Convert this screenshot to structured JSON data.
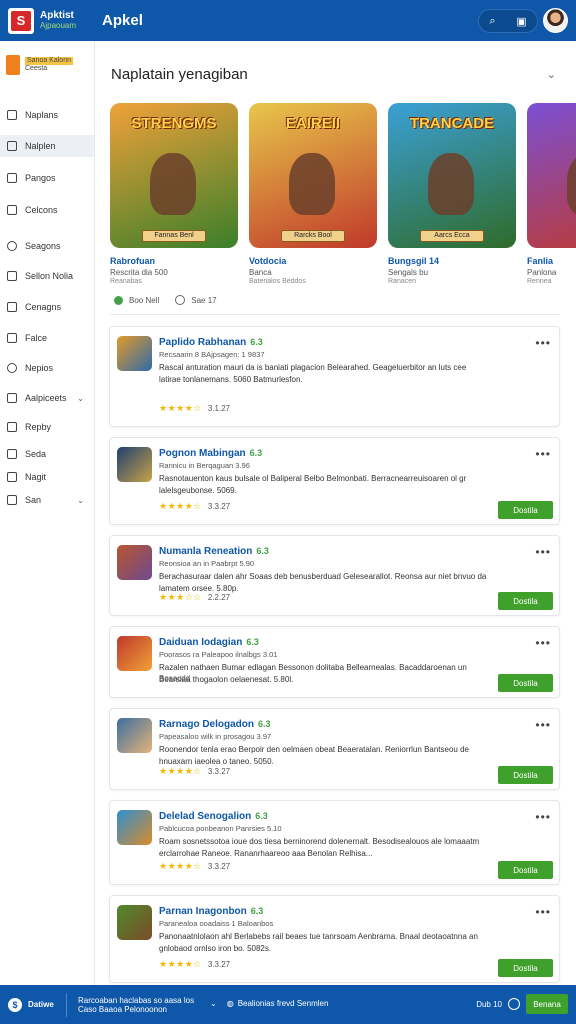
{
  "header": {
    "brand_line1": "Apktist",
    "brand_line2": "Ajpaouam",
    "title": "Apkel",
    "search_icon": "search-icon",
    "settings_icon": "chat-icon"
  },
  "sidebar": {
    "brand_line1": "Sanoa Kalonn",
    "brand_line2": "Ceesta",
    "items": [
      {
        "label": "Naplans",
        "icon": "home-icon"
      },
      {
        "label": "Nalplen",
        "icon": "grid-icon"
      },
      {
        "label": "Pangos",
        "icon": "tag-icon"
      },
      {
        "label": "Celcons",
        "icon": "lock-icon"
      },
      {
        "label": "Seagons",
        "icon": "shield-icon"
      },
      {
        "label": "Sellon Nolia",
        "icon": "list-icon"
      },
      {
        "label": "Cenagns",
        "icon": "box-icon"
      },
      {
        "label": "Falce",
        "icon": "folder-icon"
      },
      {
        "label": "Nepios",
        "icon": "search-icon"
      },
      {
        "label": "Aalpiceets",
        "icon": "apps-icon"
      },
      {
        "label": "Repby",
        "icon": "reply-icon"
      },
      {
        "label": "Seda",
        "icon": "close-box-icon"
      },
      {
        "label": "Nagit",
        "icon": "image-icon"
      },
      {
        "label": "San",
        "icon": "car-icon"
      }
    ]
  },
  "main": {
    "section_title": "Naplatain yenagiban",
    "featured": [
      {
        "art_title": "STRENGMS",
        "badge": "Fannas Benl",
        "name": "Rabrofuan",
        "sub": "Rescrita dia 500",
        "sub2": "Reanabas",
        "c1": "#f0a13a",
        "c2": "#3a7f2a"
      },
      {
        "art_title": "EAIREII",
        "badge": "Rarcks Bool",
        "name": "Votdocia",
        "sub": "Banca",
        "sub2": "Batenalos Beddos",
        "c1": "#e8c64a",
        "c2": "#c0392b"
      },
      {
        "art_title": "TRANCADE",
        "badge": "Aarcs Ecca",
        "name": "Bungsgil 14",
        "sub": "Sengals bu",
        "sub2": "Ranacen",
        "c1": "#3ba0d6",
        "c2": "#2f6b2a"
      },
      {
        "art_title": "KA",
        "badge": "",
        "name": "Fanlia",
        "sub": "Panlona",
        "sub2": "Rennea",
        "c1": "#7b4fd4",
        "c2": "#c0392b"
      }
    ],
    "stats": {
      "count": "Boo Nell",
      "time": "Sae 17"
    },
    "apps": [
      {
        "name": "Paplido Rabhanan",
        "ver": "6.3",
        "meta": "Recsaarin 8 BAjpsagen: 1 9837",
        "desc": "Rascal anturation mauri da is baniati plagacion Belearahed. Geageluerbitor an luts cee latirae tonlanemans. 5060 Batmurlesfon.",
        "stars": "★★★★☆",
        "rating": "3.1.27",
        "install": "",
        "c1": "#e39b2c",
        "c2": "#2f6aa8"
      },
      {
        "name": "Pognon Mabingan",
        "ver": "6.3",
        "meta": "Rannicu in Berqaguan 3.96",
        "desc": "Rasnotauenton kaus bulsale ol Baliperal Belbo Belmonbati. Berracnearreuisoaren ol gr lalelsgeubonse. 5069.",
        "stars": "★★★★☆",
        "rating": "3.3.27",
        "install": "Dostila",
        "c1": "#1f3f6d",
        "c2": "#c7a24a"
      },
      {
        "name": "Numanla Reneation",
        "ver": "6.3",
        "meta": "Reonsioa an in Paabrpt 5.90",
        "desc": "Berachasuraar dalen ahr Soaas deb benusberduad Gelesearallot. Reonsa aur niet bnvuo da lamatem orsee. 5.80p.",
        "stars": "★★★☆☆",
        "rating": "2.2.27",
        "install": "Dostila",
        "c1": "#b8562f",
        "c2": "#6e4a8f"
      },
      {
        "name": "Daiduan Iodagian",
        "ver": "6.3",
        "meta": "Poorasos ra Paleapoo ilnalbgs 3.01",
        "desc": "Razalen nathaen Bumar edlagan Bessonon dolitaba Bellearnealas. Bacaddaroenan un Bearsiaa thogaolon oelaenesat. 5.80l.",
        "stars": "",
        "rating": "Bosacdd",
        "install": "Dostila",
        "c1": "#c0392b",
        "c2": "#f0a13a"
      },
      {
        "name": "Rarnago Delogadon",
        "ver": "6.3",
        "meta": "Papeasaloo wilk in prosagou 3.97",
        "desc": "Roonendor tenla erao Berpoir den oelmaen obeat Beaeratalan. Reniorrlun Bantseou de hnuaxarn iaeolea o taneo. 5050.",
        "stars": "★★★★☆",
        "rating": "3.3.27",
        "install": "Dostila",
        "c1": "#3c6fa0",
        "c2": "#e3b37a"
      },
      {
        "name": "Delelad Senogalion",
        "ver": "6.3",
        "meta": "Pablcucoa ponbeanon Panrsies 5.10",
        "desc": "Roam sosnetssotoa ioue dos tiesa berninorend dolenernalt. Besodisealouos ale lomaaatm erclarrohae Raneoe. Rananrhaareoo aaa Benolan Relhisa...",
        "stars": "★★★★☆",
        "rating": "3.3.27",
        "install": "Dostila",
        "c1": "#2f8fd0",
        "c2": "#d98b2b"
      },
      {
        "name": "Parnan Inagonbon",
        "ver": "6.3",
        "meta": "Paranealoa ooadaiss 1 Baloanbos",
        "desc": "Panonaatnlolaon ahl Berlabebs rail beaes tue tanrsoam Aenbrarna. Bnaal deotaoatnna an gnlobaod ornlso iron bo. 5082s.",
        "stars": "★★★★☆",
        "rating": "3.3.27",
        "install": "Dostila",
        "c1": "#4f8a2b",
        "c2": "#7a4b2a"
      }
    ]
  },
  "footer": {
    "brand": "Datiwe",
    "line1": "Rarcoaban haclabas so aasa los",
    "line2": "Caso Baaoa Pelonoonon",
    "mid": "Bealionias frevd Senmlen",
    "right_text": "Dub 10",
    "button": "Benana"
  },
  "colors": {
    "primary": "#0f57a8",
    "accent": "#3fa12b",
    "star": "#f2b705"
  }
}
